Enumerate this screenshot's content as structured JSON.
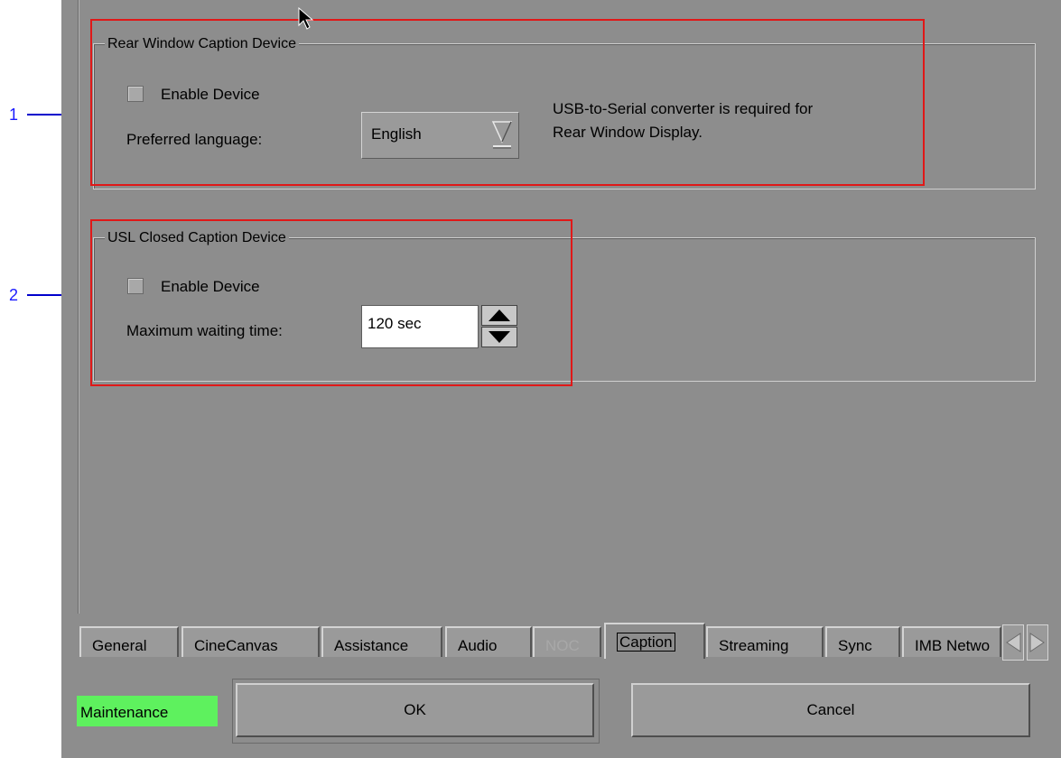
{
  "callouts": [
    "1",
    "2"
  ],
  "rear_window": {
    "legend": "Rear Window Caption Device",
    "enable_label": "Enable Device",
    "language_label": "Preferred language:",
    "language_value": "English",
    "note_line1": "USB-to-Serial converter is required for",
    "note_line2": "Rear Window Display."
  },
  "usl": {
    "legend": "USL Closed Caption Device",
    "enable_label": "Enable Device",
    "wait_label": "Maximum waiting time:",
    "wait_value": "120 sec"
  },
  "tabs": [
    {
      "label": "General",
      "state": "normal"
    },
    {
      "label": "CineCanvas",
      "state": "normal"
    },
    {
      "label": "Assistance",
      "state": "normal"
    },
    {
      "label": "Audio",
      "state": "normal"
    },
    {
      "label": "NOC",
      "state": "disabled"
    },
    {
      "label": "Caption",
      "state": "active"
    },
    {
      "label": "Streaming",
      "state": "normal"
    },
    {
      "label": "Sync",
      "state": "normal"
    },
    {
      "label": "IMB Netwo",
      "state": "normal"
    }
  ],
  "footer": {
    "status": "Maintenance",
    "ok_label": "OK",
    "cancel_label": "Cancel"
  },
  "colors": {
    "panel": "#8d8d8d",
    "highlight": "#e01818",
    "callout": "#0000cc",
    "status": "#5ef15e"
  },
  "icons": [
    "dropdown-arrow-icon",
    "spin-up-icon",
    "spin-down-icon",
    "tab-scroll-left-icon",
    "tab-scroll-right-icon",
    "mouse-cursor-icon",
    "callout-arrow-icon"
  ]
}
